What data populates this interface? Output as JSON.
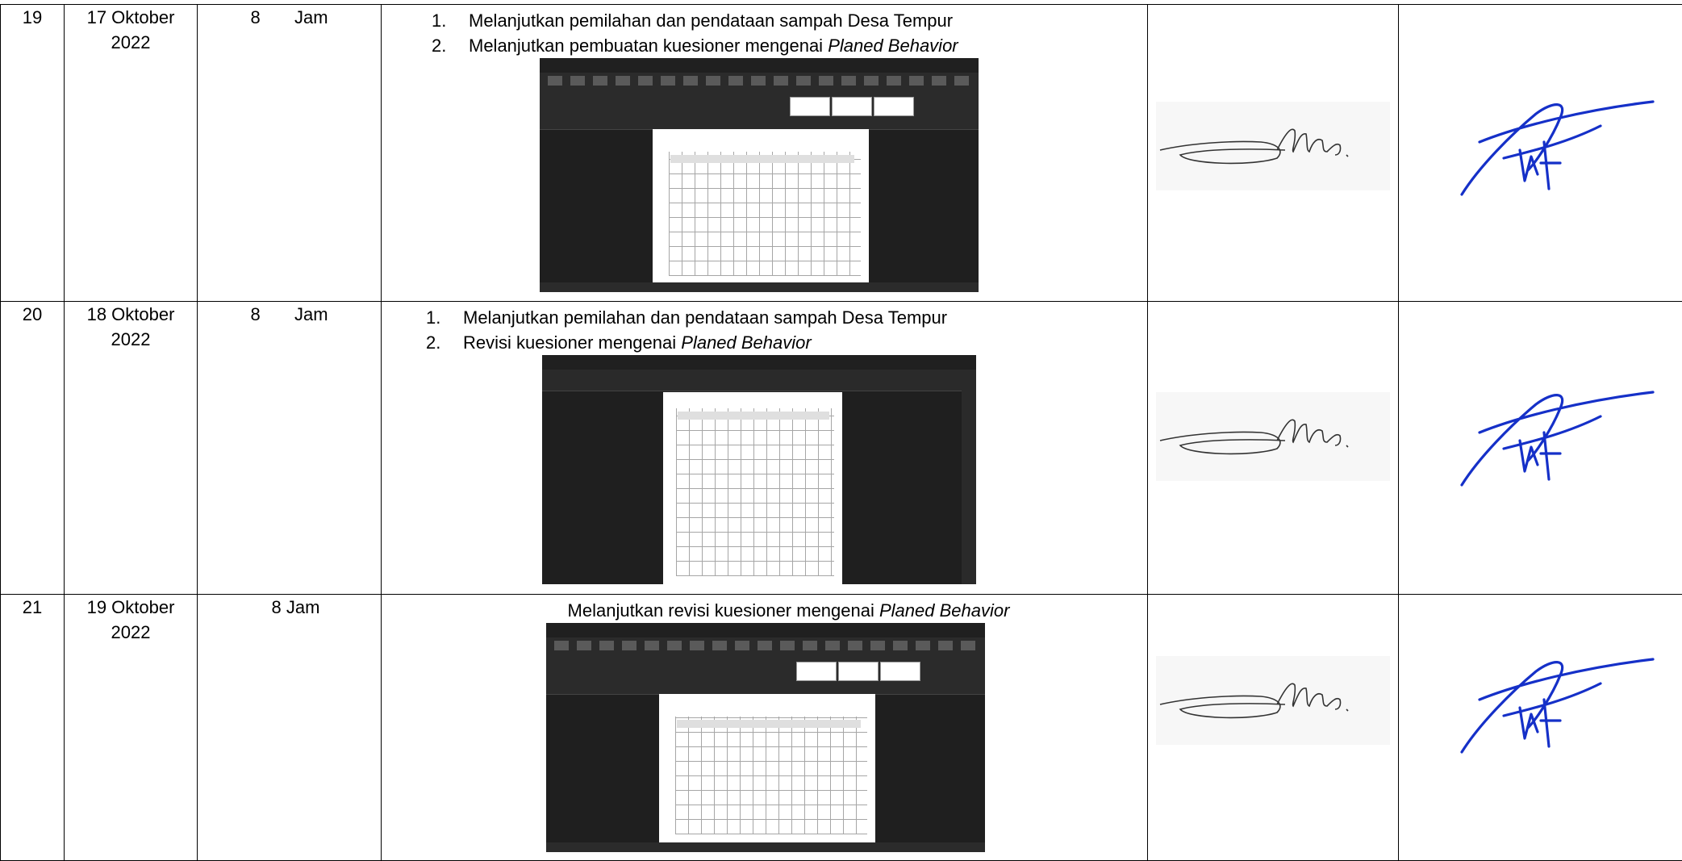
{
  "rows": [
    {
      "no": "19",
      "date_line1": "17 Oktober",
      "date_line2": "2022",
      "duration_num": "8",
      "duration_unit": "Jam",
      "activities": [
        {
          "num": "1.",
          "text": "Melanjutkan pemilahan dan pendataan sampah Desa Tempur",
          "italic": ""
        },
        {
          "num": "2.",
          "text": "Melanjutkan pembuatan kuesioner mengenai ",
          "italic": "Planed Behavior"
        }
      ],
      "screenshot": "word-document-screenshot"
    },
    {
      "no": "20",
      "date_line1": "18 Oktober",
      "date_line2": "2022",
      "duration_num": "8",
      "duration_unit": "Jam",
      "activities": [
        {
          "num": "1.",
          "text": "Melanjutkan pemilahan dan pendataan sampah Desa Tempur",
          "italic": ""
        },
        {
          "num": "2.",
          "text": "Revisi kuesioner mengenai ",
          "italic": "Planed Behavior"
        }
      ],
      "screenshot": "pdf-viewer-screenshot"
    },
    {
      "no": "21",
      "date_line1": "19 Oktober",
      "date_line2": "2022",
      "duration_combined": "8 Jam",
      "activity_single": {
        "text": "Melanjutkan revisi kuesioner mengenai ",
        "italic": "Planed Behavior"
      },
      "screenshot": "word-document-screenshot"
    }
  ],
  "signature_icon_1": "student-signature",
  "signature_icon_2": "supervisor-signature"
}
